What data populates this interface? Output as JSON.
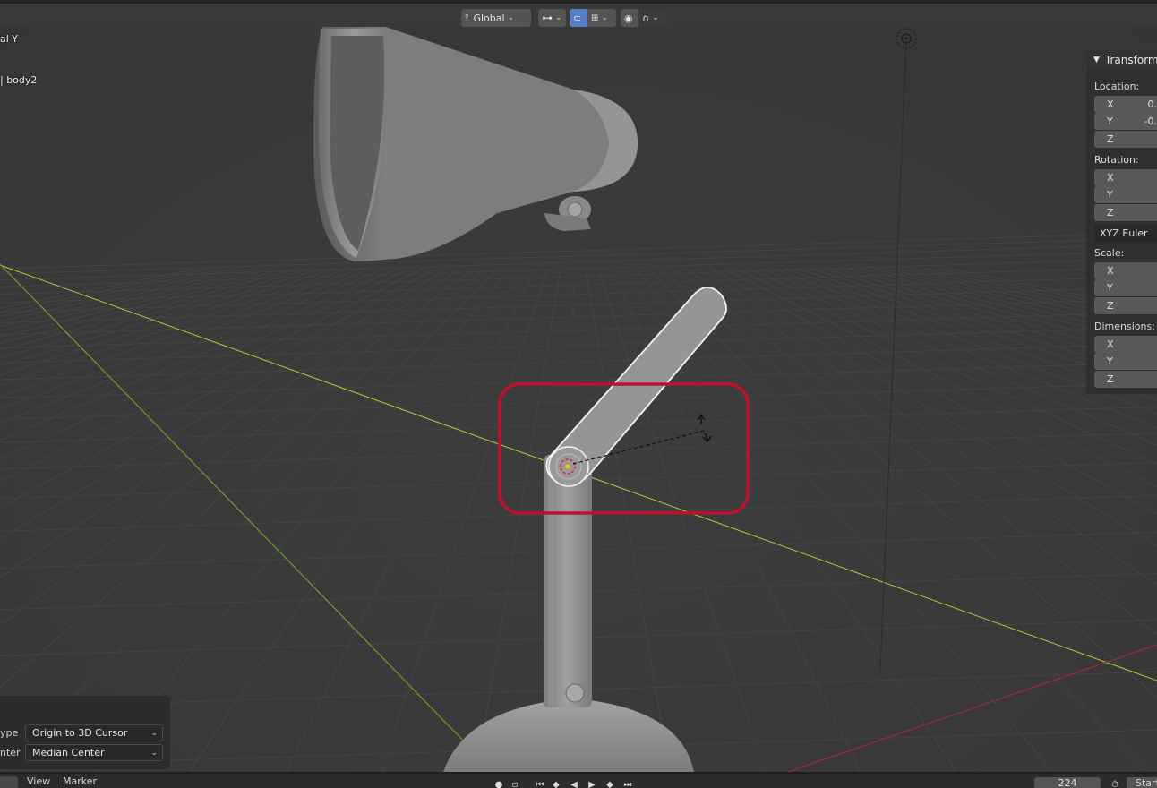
{
  "header": {
    "transform_orientation": "Global"
  },
  "viewport": {
    "axis_text": "al Y",
    "object_text": "| body2"
  },
  "transform_panel": {
    "title": "Transform",
    "location_label": "Location:",
    "location": [
      {
        "axis": "X",
        "value": "0."
      },
      {
        "axis": "Y",
        "value": "-0."
      },
      {
        "axis": "Z",
        "value": ""
      }
    ],
    "rotation_label": "Rotation:",
    "rotation": [
      {
        "axis": "X"
      },
      {
        "axis": "Y"
      },
      {
        "axis": "Z"
      }
    ],
    "rotation_mode": "XYZ Euler",
    "scale_label": "Scale:",
    "scale": [
      {
        "axis": "X"
      },
      {
        "axis": "Y"
      },
      {
        "axis": "Z"
      }
    ],
    "dimensions_label": "Dimensions:",
    "dimensions": [
      {
        "axis": "X"
      },
      {
        "axis": "Y"
      },
      {
        "axis": "Z"
      }
    ]
  },
  "operator_panel": {
    "type_label": "ype",
    "type_value": "Origin to 3D Cursor",
    "center_label": "nter",
    "center_value": "Median Center"
  },
  "timeline": {
    "view_label": "View",
    "marker_label": "Marker",
    "current_frame": "224",
    "start_label": "Start"
  },
  "colors": {
    "highlight_box": "#c0102a",
    "x_axis": "#c4303f",
    "y_axis": "#8ec23a",
    "selection_outline": "#f2f2f2"
  }
}
